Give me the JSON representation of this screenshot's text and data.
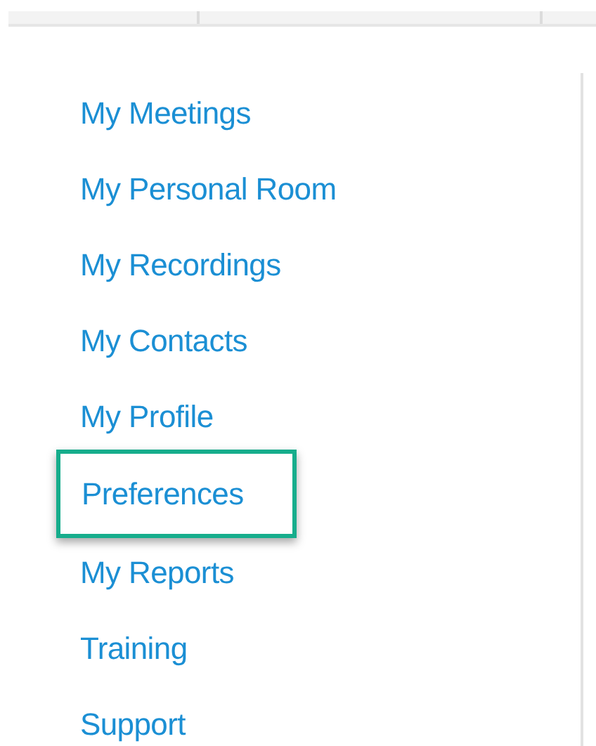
{
  "menu": [
    {
      "label": "My Meetings",
      "selected": false
    },
    {
      "label": "My Personal Room",
      "selected": false
    },
    {
      "label": "My Recordings",
      "selected": false
    },
    {
      "label": "My Contacts",
      "selected": false
    },
    {
      "label": "My Profile",
      "selected": false
    },
    {
      "label": "Preferences",
      "selected": true
    },
    {
      "label": "My Reports",
      "selected": false
    },
    {
      "label": "Training",
      "selected": false
    },
    {
      "label": "Support",
      "selected": false
    }
  ]
}
